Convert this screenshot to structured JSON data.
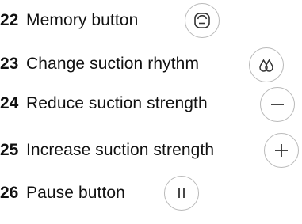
{
  "legend": {
    "items": [
      {
        "number": "22",
        "label": "Memory button",
        "icon": "face-icon"
      },
      {
        "number": "23",
        "label": "Change suction rhythm",
        "icon": "drops-icon"
      },
      {
        "number": "24",
        "label": "Reduce suction strength",
        "icon": "minus-icon"
      },
      {
        "number": "25",
        "label": "Increase suction strength",
        "icon": "plus-icon"
      },
      {
        "number": "26",
        "label": "Pause button",
        "icon": "pause-icon"
      }
    ]
  },
  "colors": {
    "text": "#111111",
    "icon_ring": "#b9b9b9",
    "icon_glyph": "#333333"
  }
}
